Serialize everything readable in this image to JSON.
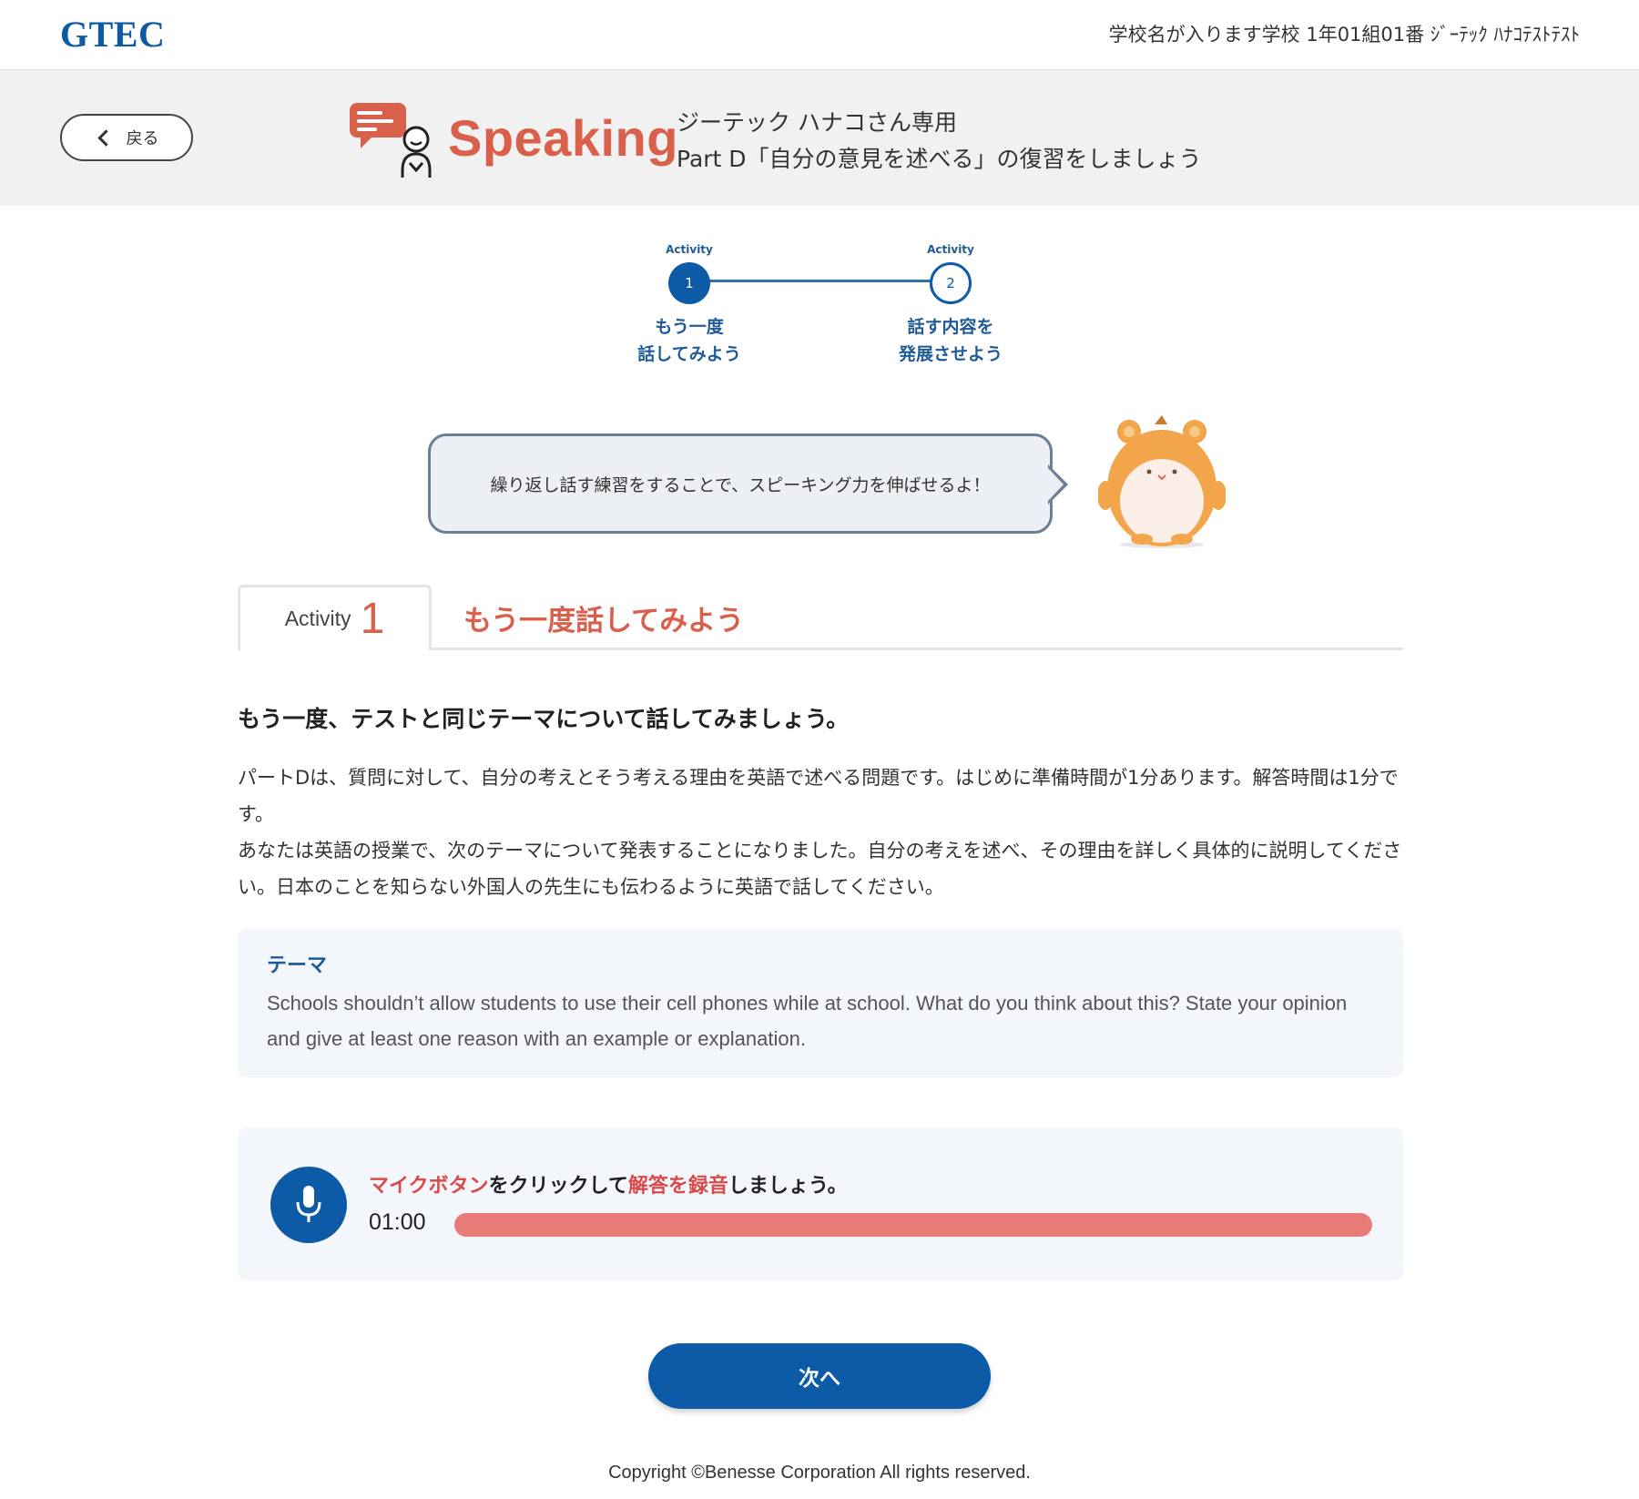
{
  "topbar": {
    "logo": "GTEC",
    "user_info": "学校名が入ります学校 1年01組01番 ｼﾞｰﾃｯｸ ﾊﾅｺﾃｽﾄﾃｽﾄ"
  },
  "header": {
    "back_label": "戻る",
    "section_title": "Speaking",
    "subtitle_line1": "ジーテック ハナコさん専用",
    "subtitle_line2": "Part D「自分の意見を述べる」の復習をしましょう"
  },
  "stepper": {
    "steps": [
      {
        "activity_label": "Activity",
        "number": "1",
        "label": "もう一度\n話してみよう",
        "state": "active"
      },
      {
        "activity_label": "Activity",
        "number": "2",
        "label": "話す内容を\n発展させよう",
        "state": "inactive"
      }
    ]
  },
  "bubble": {
    "text": "繰り返し話す練習をすることで、スピーキング力を伸ばせるよ！"
  },
  "activity_tab": {
    "word": "Activity",
    "number": "1",
    "title": "もう一度話してみよう"
  },
  "content": {
    "lead": "もう一度、テストと同じテーマについて話してみましょう。",
    "desc_line1": "パートDは、質問に対して、自分の考えとそう考える理由を英語で述べる問題です。はじめに準備時間が1分あります。解答時間は1分です。",
    "desc_line2": "あなたは英語の授業で、次のテーマについて発表することになりました。自分の考えを述べ、その理由を詳しく具体的に説明してください。日本のことを知らない外国人の先生にも伝わるように英語で話してください。"
  },
  "theme": {
    "label": "テーマ",
    "text": "Schools shouldn’t allow students to use their cell phones while at school. What do you think about this? State your opinion and give at least one reason with an example or explanation."
  },
  "recorder": {
    "instr_part1": "マイクボタン",
    "instr_part2": "をクリックして",
    "instr_part3": "解答を録音",
    "instr_part4": "しましょう。",
    "time": "01:00",
    "progress": 1.0
  },
  "next_label": "次へ",
  "copyright": "Copyright ©Benesse Corporation All rights reserved.",
  "colors": {
    "brand_blue": "#0d5aa7",
    "accent_orange": "#d9614c",
    "record_bar": "#e87b78",
    "highlight_red": "#d94a4a"
  }
}
